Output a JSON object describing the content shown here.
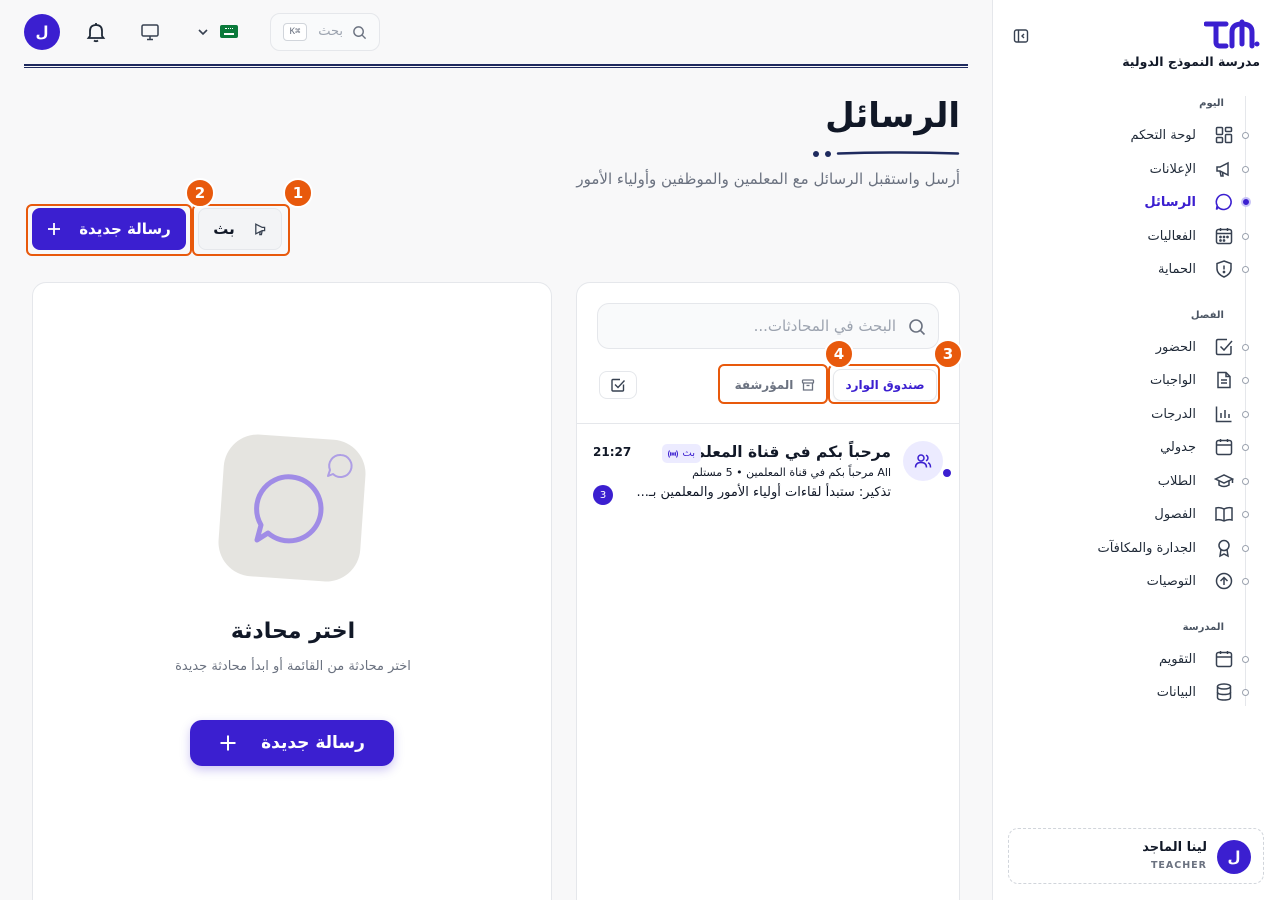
{
  "brand": {
    "name": "مدرسة النموذج الدولية"
  },
  "sidebar": {
    "sections": [
      {
        "label": "اليوم"
      },
      {
        "label": "الفصل"
      },
      {
        "label": "المدرسة"
      }
    ],
    "items": [
      {
        "label": "لوحة التحكم",
        "icon": "dashboard-icon"
      },
      {
        "label": "الإعلانات",
        "icon": "megaphone-icon"
      },
      {
        "label": "الرسائل",
        "icon": "message-icon",
        "active": true
      },
      {
        "label": "الفعاليات",
        "icon": "calendar-grid-icon"
      },
      {
        "label": "الحماية",
        "icon": "shield-icon"
      },
      {
        "label": "الحضور",
        "icon": "check-square-icon"
      },
      {
        "label": "الواجبات",
        "icon": "document-icon"
      },
      {
        "label": "الدرجات",
        "icon": "bar-chart-icon"
      },
      {
        "label": "جدولي",
        "icon": "calendar-icon"
      },
      {
        "label": "الطلاب",
        "icon": "graduation-cap-icon"
      },
      {
        "label": "الفصول",
        "icon": "book-open-icon"
      },
      {
        "label": "الجدارة والمكافآت",
        "icon": "award-icon"
      },
      {
        "label": "التوصيات",
        "icon": "arrow-up-circle-icon"
      },
      {
        "label": "التقويم",
        "icon": "calendar-icon"
      },
      {
        "label": "البيانات",
        "icon": "database-icon"
      }
    ]
  },
  "user": {
    "initial": "ل",
    "name": "لينا الماجد",
    "role": "TEACHER"
  },
  "topbar": {
    "avatar_initial": "ل",
    "search_label": "بحث",
    "shortcut": "K⌘"
  },
  "page": {
    "title": "الرسائل",
    "subtitle": "أرسل واستقبل الرسائل مع المعلمين والموظفين وأولياء الأمور",
    "new_message_label": "رسالة جديدة",
    "broadcast_label": "بث"
  },
  "markers": [
    "1",
    "2",
    "3",
    "4"
  ],
  "conversations": {
    "search_placeholder": "البحث في المحادثات...",
    "tabs": {
      "inbox": "صندوق الوارد",
      "archived": "المؤرشفة"
    },
    "items": [
      {
        "title": "مرحباً بكم في قناة المعلمين",
        "tag": "بث",
        "time": "21:27",
        "meta": "All مرحباً بكم في قناة المعلمين • 5 مستلم",
        "preview": "تذكير: ستبدأ لقاءات أولياء الأمور والمعلمين بـ...",
        "unread_count": "3"
      }
    ]
  },
  "empty_state": {
    "title": "اختر محادثة",
    "description": "اختر محادثة من القائمة أو ابدأ محادثة جديدة",
    "button_label": "رسالة جديدة"
  },
  "colors": {
    "accent": "#3b1fd0",
    "annotation": "#e8590c",
    "rule": "#1e2a5e"
  }
}
